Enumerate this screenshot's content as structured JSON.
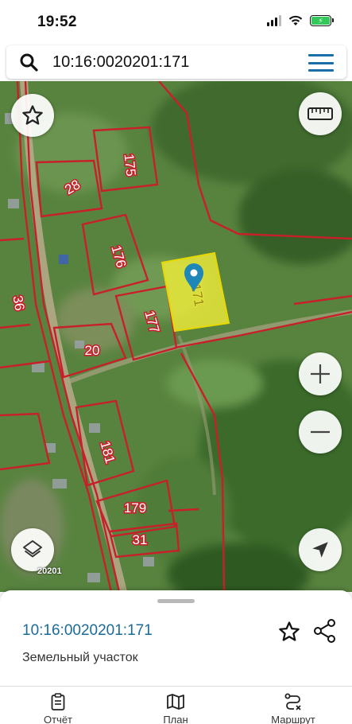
{
  "status_bar": {
    "time": "19:52",
    "battery_fill": 1.0
  },
  "search": {
    "query": "10:16:0020201:171"
  },
  "map": {
    "parcel_labels": [
      "175",
      "28",
      "176",
      "171",
      "177",
      "20",
      "36",
      "181",
      "179",
      "31"
    ],
    "scale_text": "20201"
  },
  "sheet": {
    "title": "10:16:0020201:171",
    "subtitle": "Земельный участок"
  },
  "tabs": [
    {
      "label": "Отчёт",
      "icon": "clipboard-icon"
    },
    {
      "label": "План",
      "icon": "map-icon"
    },
    {
      "label": "Маршрут",
      "icon": "route-icon"
    }
  ],
  "colors": {
    "accent": "#1a6fa8",
    "parcel_border": "#c8202a",
    "selected_parcel": "#f2ee3a",
    "map_pin": "#1f86b8"
  }
}
